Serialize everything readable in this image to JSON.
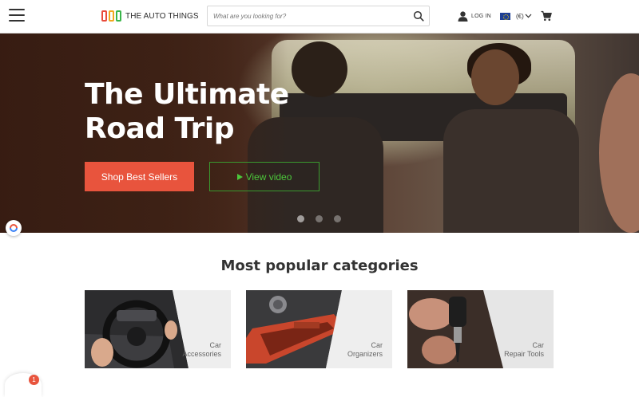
{
  "header": {
    "brand_name": "THE AUTO THINGS",
    "search": {
      "placeholder": "What are you looking for?",
      "value": ""
    },
    "login_label": "LOG IN",
    "currency_label": "(€)",
    "icons": [
      "menu-icon",
      "search-icon",
      "user-icon",
      "eu-flag-icon",
      "chevron-down-icon",
      "cart-icon"
    ]
  },
  "hero": {
    "title_line1": "The Ultimate",
    "title_line2": "Road Trip",
    "primary_button": "Shop Best Sellers",
    "video_button": "Play video",
    "video_button_text": "View video",
    "slides_count": 3,
    "active_slide": 1
  },
  "categories": {
    "title": "Most popular categories",
    "items": [
      {
        "line1": "Car",
        "line2": "Accessories"
      },
      {
        "line1": "Car",
        "line2": "Organizers"
      },
      {
        "line1": "Car",
        "line2": "Repair Tools"
      }
    ]
  },
  "chat": {
    "badge_count": "1"
  },
  "colors": {
    "accent": "#e8543d",
    "video_green": "#4cc73b",
    "logo_red": "#e84b3c",
    "logo_orange": "#f2a71e",
    "logo_green": "#3ab54a"
  }
}
